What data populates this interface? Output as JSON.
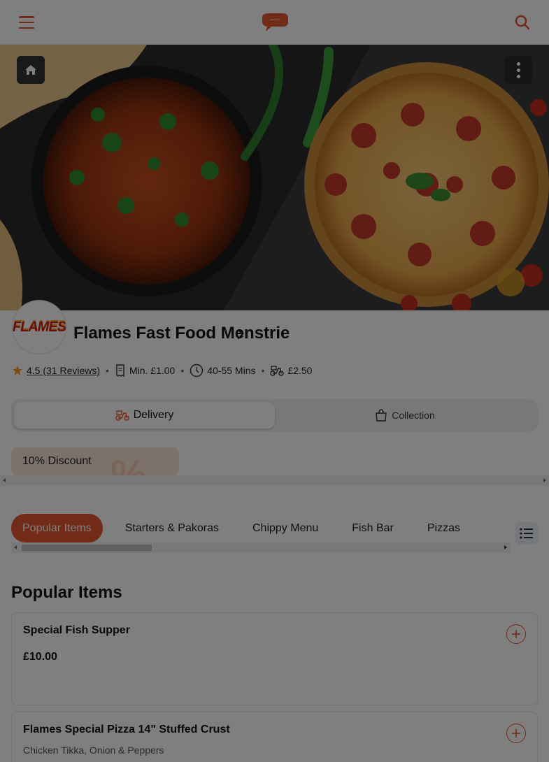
{
  "header": {
    "menu_icon": "hamburger-icon",
    "logo_icon": "speech-bubble-logo",
    "search_icon": "search-icon"
  },
  "hero": {
    "home_icon": "home-icon",
    "more_icon": "more-vertical-icon"
  },
  "restaurant": {
    "badge_text": "FLAMES",
    "name": "Flames Fast Food Menstrie",
    "rating": "4.5 (31 Reviews)",
    "min_order": "Min. £1.00",
    "delivery_time": "40-55 Mins",
    "delivery_fee": "£2.50"
  },
  "order_mode": {
    "delivery_label": "Delivery",
    "collection_label": "Collection",
    "selected": "Delivery"
  },
  "offers": {
    "discount_label": "10% Discount"
  },
  "categories": [
    {
      "label": "Popular Items",
      "active": true
    },
    {
      "label": "Starters & Pakoras",
      "active": false
    },
    {
      "label": "Chippy Menu",
      "active": false
    },
    {
      "label": "Fish Bar",
      "active": false
    },
    {
      "label": "Pizzas",
      "active": false
    }
  ],
  "section": {
    "title": "Popular Items"
  },
  "items": [
    {
      "name": "Special Fish Supper",
      "price": "£10.00"
    },
    {
      "name": "Flames Special Pizza 14\" Stuffed Crust",
      "description": "Chicken Tikka, Onion & Peppers"
    }
  ],
  "colors": {
    "accent": "#e4572e",
    "overlay": "rgba(0,0,0,0.5)"
  }
}
